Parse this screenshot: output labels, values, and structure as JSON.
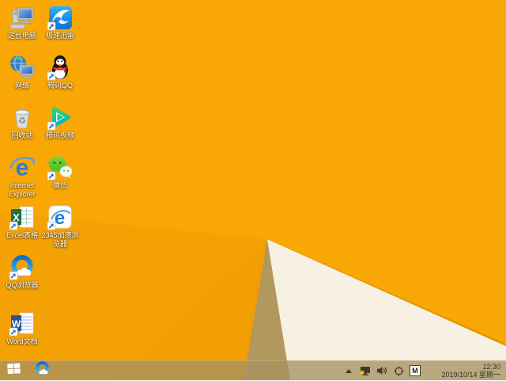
{
  "desktop": {
    "icons": [
      {
        "label": "这台电脑"
      },
      {
        "label": "极速迅雷"
      },
      {
        "label": "网络"
      },
      {
        "label": "腾讯QQ"
      },
      {
        "label": "回收站"
      },
      {
        "label": "腾讯视频"
      },
      {
        "label": "Internet Explorer"
      },
      {
        "label": "微信"
      },
      {
        "label": "Excel表格"
      },
      {
        "label": "2345加速浏览器"
      },
      {
        "label": "QQ浏览器"
      },
      {
        "label": "Word文档"
      }
    ]
  },
  "taskbar": {
    "tray": {
      "ime_label": "M"
    },
    "clock": {
      "time": "12:30",
      "date": "2019/10/14 星期一"
    }
  },
  "colors": {
    "wallpaper_main": "#F8A704",
    "wallpaper_deep": "#F4A103",
    "wallpaper_shadow_edge": "#E59201",
    "wallpaper_khaki": "#B2985C",
    "wallpaper_cream": "#F6F1E2",
    "taskbar_tint": "rgba(168,146,96,0.78)",
    "tray_icon_ink": "#3e3a30"
  }
}
